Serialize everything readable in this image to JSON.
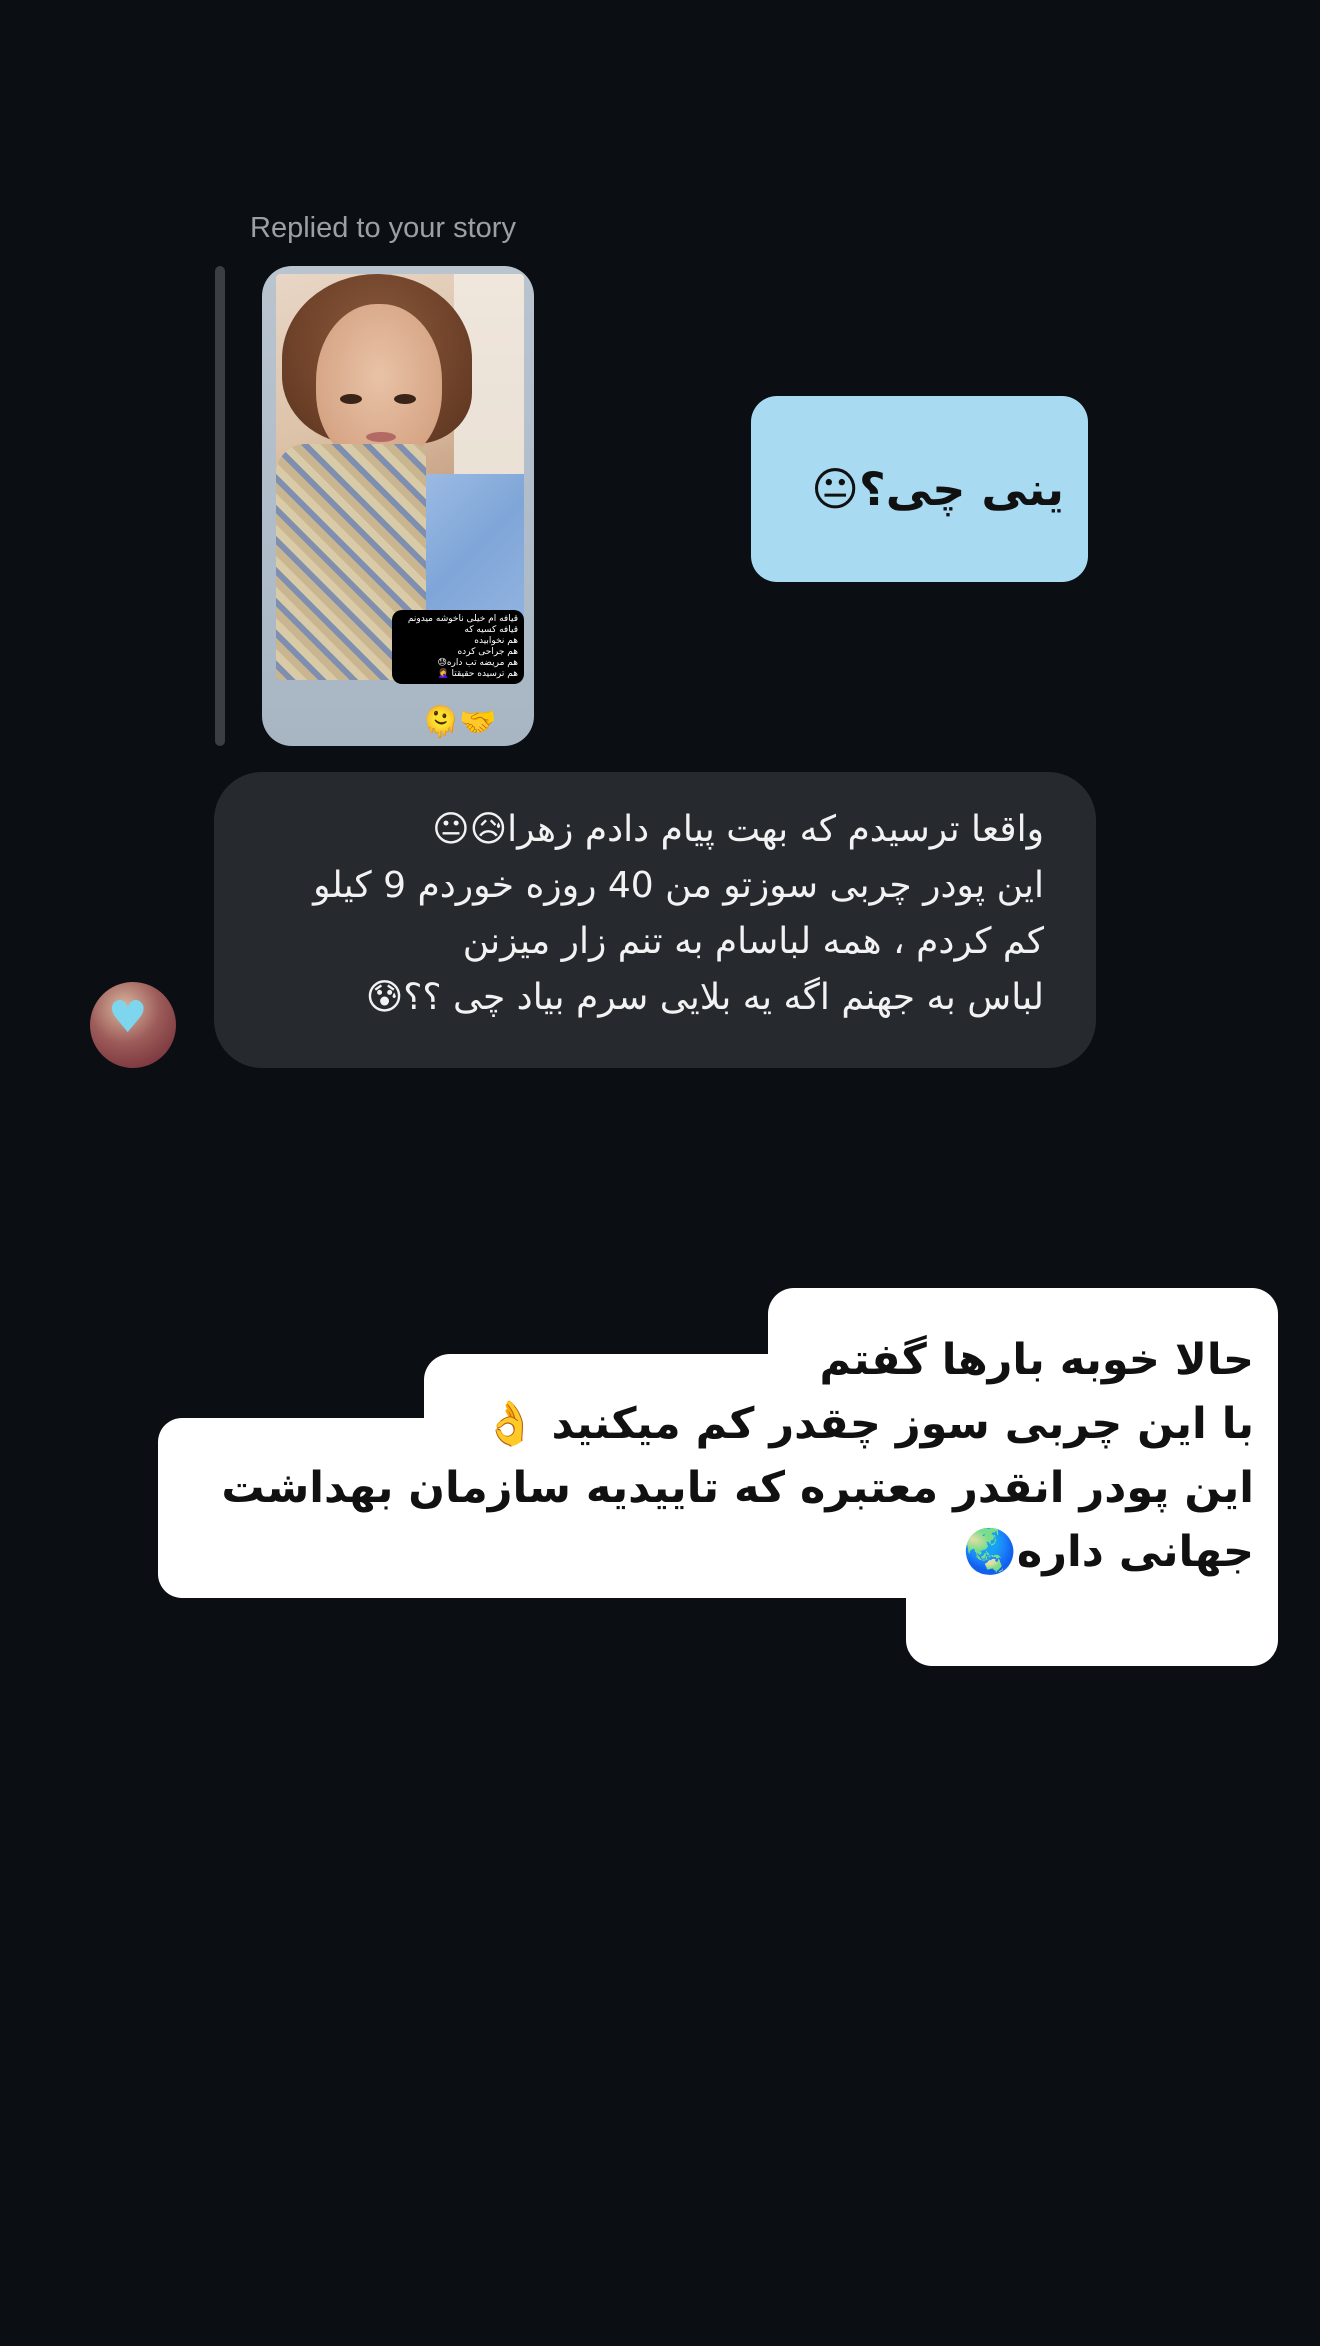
{
  "reply_label": "Replied to your story",
  "story": {
    "caption_lines": [
      "قیافه ام خیلی ناخوشه میدونم",
      "قیافه کسیه که",
      "هم نخوابیده",
      "هم جراحی کرده",
      "هم مریضه تب داره😓",
      "هم ترسیده حقیقتا 🤦‍♀️"
    ],
    "sticker_emoji": "🫠🤝"
  },
  "sent_message": {
    "text": "ینی چی؟😐"
  },
  "received_message": {
    "lines": [
      "واقعا ترسیدم که بهت پیام دادم زهرا😥😐",
      "این  پودر چربی سوزتو من 40 روزه خوردم 9 کیلو",
      "کم کردم ، همه لباسام به تنم زار میزنن",
      "لباس به جهنم اگه یه بلایی سرم بیاد چی ؟؟😰"
    ]
  },
  "overlay_text": {
    "lines": [
      "حالا خوبه بارها گفتم",
      "با این چربی سوز چقدر کم میکنید 👌",
      "این پودر انقدر معتبره که تاییدیه سازمان بهداشت",
      "جهانی داره🌏"
    ]
  },
  "colors": {
    "background": "#0b0f13",
    "sent_bubble": "#a8daf2",
    "received_bubble": "#262a2f",
    "overlay_box": "#ffffff",
    "muted_text": "#9aa0a6"
  },
  "icons": {
    "avatar_overlay": "heart-emoji"
  }
}
